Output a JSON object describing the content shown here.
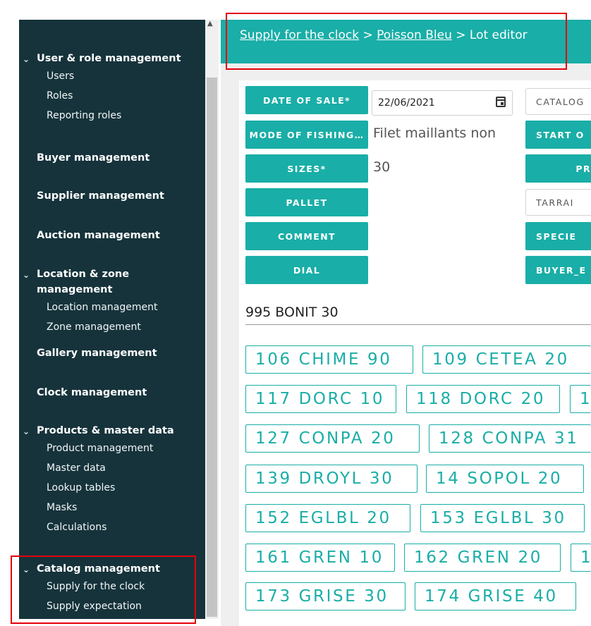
{
  "sidebar": {
    "groups": [
      {
        "title": "User & role management",
        "expanded": true,
        "items": [
          "Users",
          "Roles",
          "Reporting roles"
        ]
      },
      {
        "title": "Buyer management",
        "expanded": false,
        "items": []
      },
      {
        "title": "Supplier management",
        "expanded": false,
        "items": []
      },
      {
        "title": "Auction management",
        "expanded": false,
        "items": []
      },
      {
        "title": "Location & zone management",
        "expanded": true,
        "items": [
          "Location management",
          "Zone management"
        ]
      },
      {
        "title": "Gallery management",
        "expanded": false,
        "items": []
      },
      {
        "title": "Clock management",
        "expanded": false,
        "items": []
      },
      {
        "title": "Products & master data",
        "expanded": true,
        "items": [
          "Product management",
          "Master data",
          "Lookup tables",
          "Masks",
          "Calculations"
        ]
      },
      {
        "title": "Catalog management",
        "expanded": true,
        "items": [
          "Supply for the clock",
          "Supply expectation"
        ]
      }
    ]
  },
  "breadcrumb": {
    "items": [
      "Supply for the clock",
      "Poisson Bleu"
    ],
    "current": "Lot editor",
    "separator": ">"
  },
  "form": {
    "left_buttons": [
      "DATE OF SALE*",
      "MODE OF FISHING…",
      "SIZES*",
      "PALLET",
      "COMMENT",
      "DIAL"
    ],
    "date_value": "22/06/2021",
    "fishing_value": "Filet maillants non",
    "sizes_value": "30",
    "right_controls": [
      {
        "kind": "field",
        "text": "CATALOG"
      },
      {
        "kind": "button",
        "text": "START O"
      },
      {
        "kind": "button",
        "text": "PR"
      },
      {
        "kind": "field",
        "text": "TARRAI"
      },
      {
        "kind": "button",
        "text": "SPECIE"
      },
      {
        "kind": "button",
        "text": "BUYER_E"
      }
    ]
  },
  "lot_name": "995 BONIT 30",
  "lot_chips": [
    [
      "106 CHIME 90",
      "109 CETEA 20"
    ],
    [
      "117 DORC 10",
      "118 DORC 20",
      "1"
    ],
    [
      "127 CONPA 20",
      "128 CONPA 31"
    ],
    [
      "139 DROYL 30",
      "14 SOPOL 20"
    ],
    [
      "152 EGLBL 20",
      "153 EGLBL 30"
    ],
    [
      "161 GREN 10",
      "162 GREN 20",
      "1"
    ],
    [
      "173 GRISE 30",
      "174 GRISE 40"
    ]
  ],
  "colors": {
    "accent": "#19aea7",
    "sidebar_bg": "#16333b",
    "highlight": "#e3000b"
  }
}
